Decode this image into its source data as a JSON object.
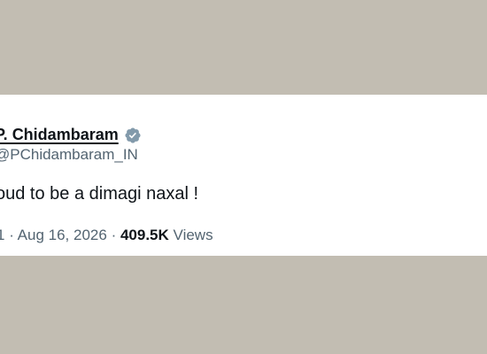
{
  "tweet": {
    "author_name": "P. Chidambaram",
    "handle": "@PChidambaram_IN",
    "verified_icon": "verified-badge-icon",
    "text": "oud to be a dimagi naxal !",
    "time_fragment": "1",
    "date": "Aug 16, 2026",
    "separator": "·",
    "views_count": "409.5K",
    "views_label": "Views"
  },
  "colors": {
    "backdrop": "#c2bdb2",
    "card": "#ffffff",
    "primary_text": "#0f1419",
    "secondary_text": "#536471",
    "verified_badge": "#829aab"
  }
}
